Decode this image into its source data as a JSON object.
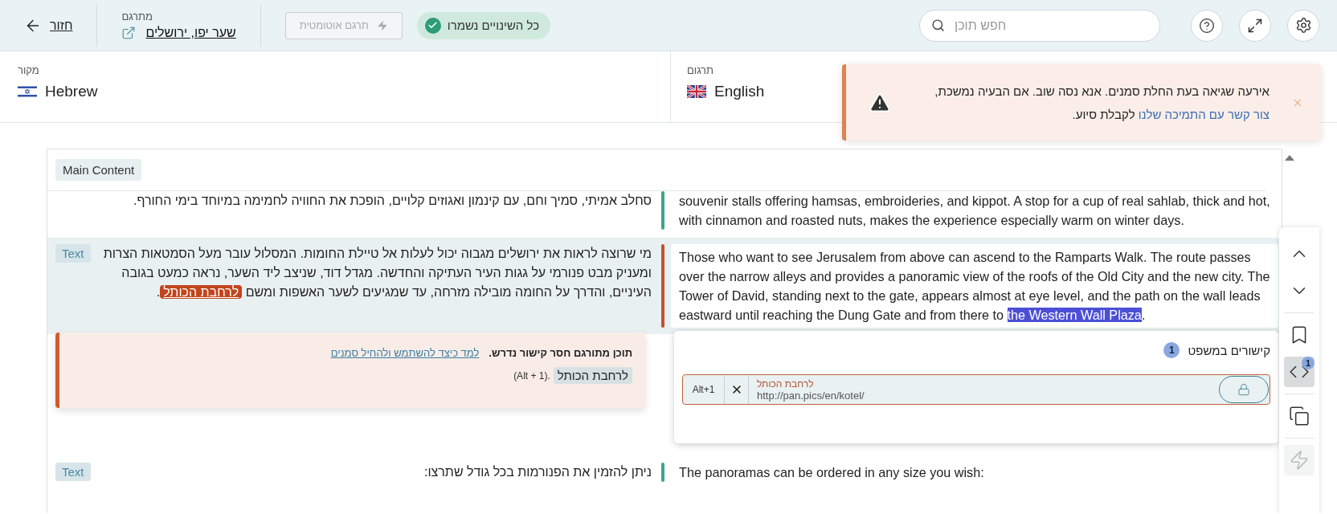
{
  "header": {
    "back": "חזור",
    "project_label": "מתרגם",
    "project_name": "שער יפו, ירושלים",
    "auto_translate": {
      "label": "תרגם אוטומטית",
      "disabled": true
    },
    "saved_status": "כל השינויים נשמרו",
    "search": {
      "placeholder": "חפש תוכן"
    }
  },
  "languages": {
    "source": {
      "label": "מקור",
      "name": "Hebrew"
    },
    "target": {
      "label": "תרגום",
      "name": "English"
    }
  },
  "toast": {
    "message": "אירעה שגיאה בעת החלת סמנים. אנא נסה שוב. אם הבעיה נמשכת,",
    "link": "צור קשר עם התמיכה שלנו",
    "tail": "לקבלת סיוע."
  },
  "section_tag": "Main Content",
  "segments": [
    {
      "flagged": false,
      "selected": false,
      "source": [
        {
          "text": "סחלב אמיתי, סמיך וחם, עם קינמון ואגוזים קלויים, הופכת את החוויה לחמימה במיוחד בימי החורף."
        }
      ],
      "target": [
        {
          "text": "souvenir stalls offering hamsas, embroideries, and kippot. A stop for a cup of real sahlab, thick and hot, with cinnamon and roasted nuts, makes the experience especially warm on winter days."
        }
      ]
    },
    {
      "flagged": true,
      "selected": true,
      "tag": "Text",
      "source": [
        {
          "text": "מי שרוצה לראות את ירושלים מגבוה יכול לעלות אל טיילת החומות. המסלול עובר מעל הסמטאות הצרות ומעניק מבט פנורמי על גגות העיר העתיקה והחדשה. מגדל דוד, שניצב ליד השער, נראה כמעט בגובה העיניים, והדרך על החומה מובילה מזרחה, עד שמגיעים לשער האשפות ומשם "
        },
        {
          "text": "לרחבת הכותל",
          "kind": "marker"
        },
        {
          "text": "."
        }
      ],
      "target": [
        {
          "text": "Those who want to see Jerusalem from above can ascend to the Ramparts Walk. The route passes over the narrow alleys and provides a panoramic view of the roofs of the Old City and the new city. The Tower of David, standing next to the gate, appears almost at eye level, and the path on the wall leads eastward until reaching the Dung Gate and from there to ",
          "highlight": "the Western Wall Plaza",
          "after": "."
        }
      ],
      "error": {
        "title": "תוכן מתורגם חסר קישור נדרש.",
        "link": "למד כיצד להשתמש ולהחיל סמנים",
        "chip": "לרחבת הכותל",
        "hint": "(Alt + 1)."
      },
      "links": {
        "title": "קישורים במשפט",
        "count": "1",
        "items": [
          {
            "shortcut": "Alt+1",
            "text": "לרחבת הכותל",
            "url": "http://pan.pics/en/kotel/"
          }
        ]
      }
    },
    {
      "flagged": false,
      "selected": false,
      "tag": "Text",
      "source": [
        {
          "text": "ניתן להזמין את הפנורמות בכל גודל שתרצו:"
        }
      ],
      "target": [
        {
          "text": "The panoramas can be ordered in any size you wish:"
        }
      ]
    }
  ],
  "toolbar": [
    {
      "kind": "up",
      "selected": false,
      "disabled": false
    },
    {
      "kind": "down",
      "selected": false,
      "disabled": false
    },
    {
      "kind": "bookmark",
      "selected": false,
      "disabled": false
    },
    {
      "kind": "code",
      "selected": true,
      "disabled": false,
      "badge": "1"
    },
    {
      "kind": "copy",
      "selected": false,
      "disabled": false
    },
    {
      "kind": "bolt",
      "selected": false,
      "disabled": true
    }
  ]
}
